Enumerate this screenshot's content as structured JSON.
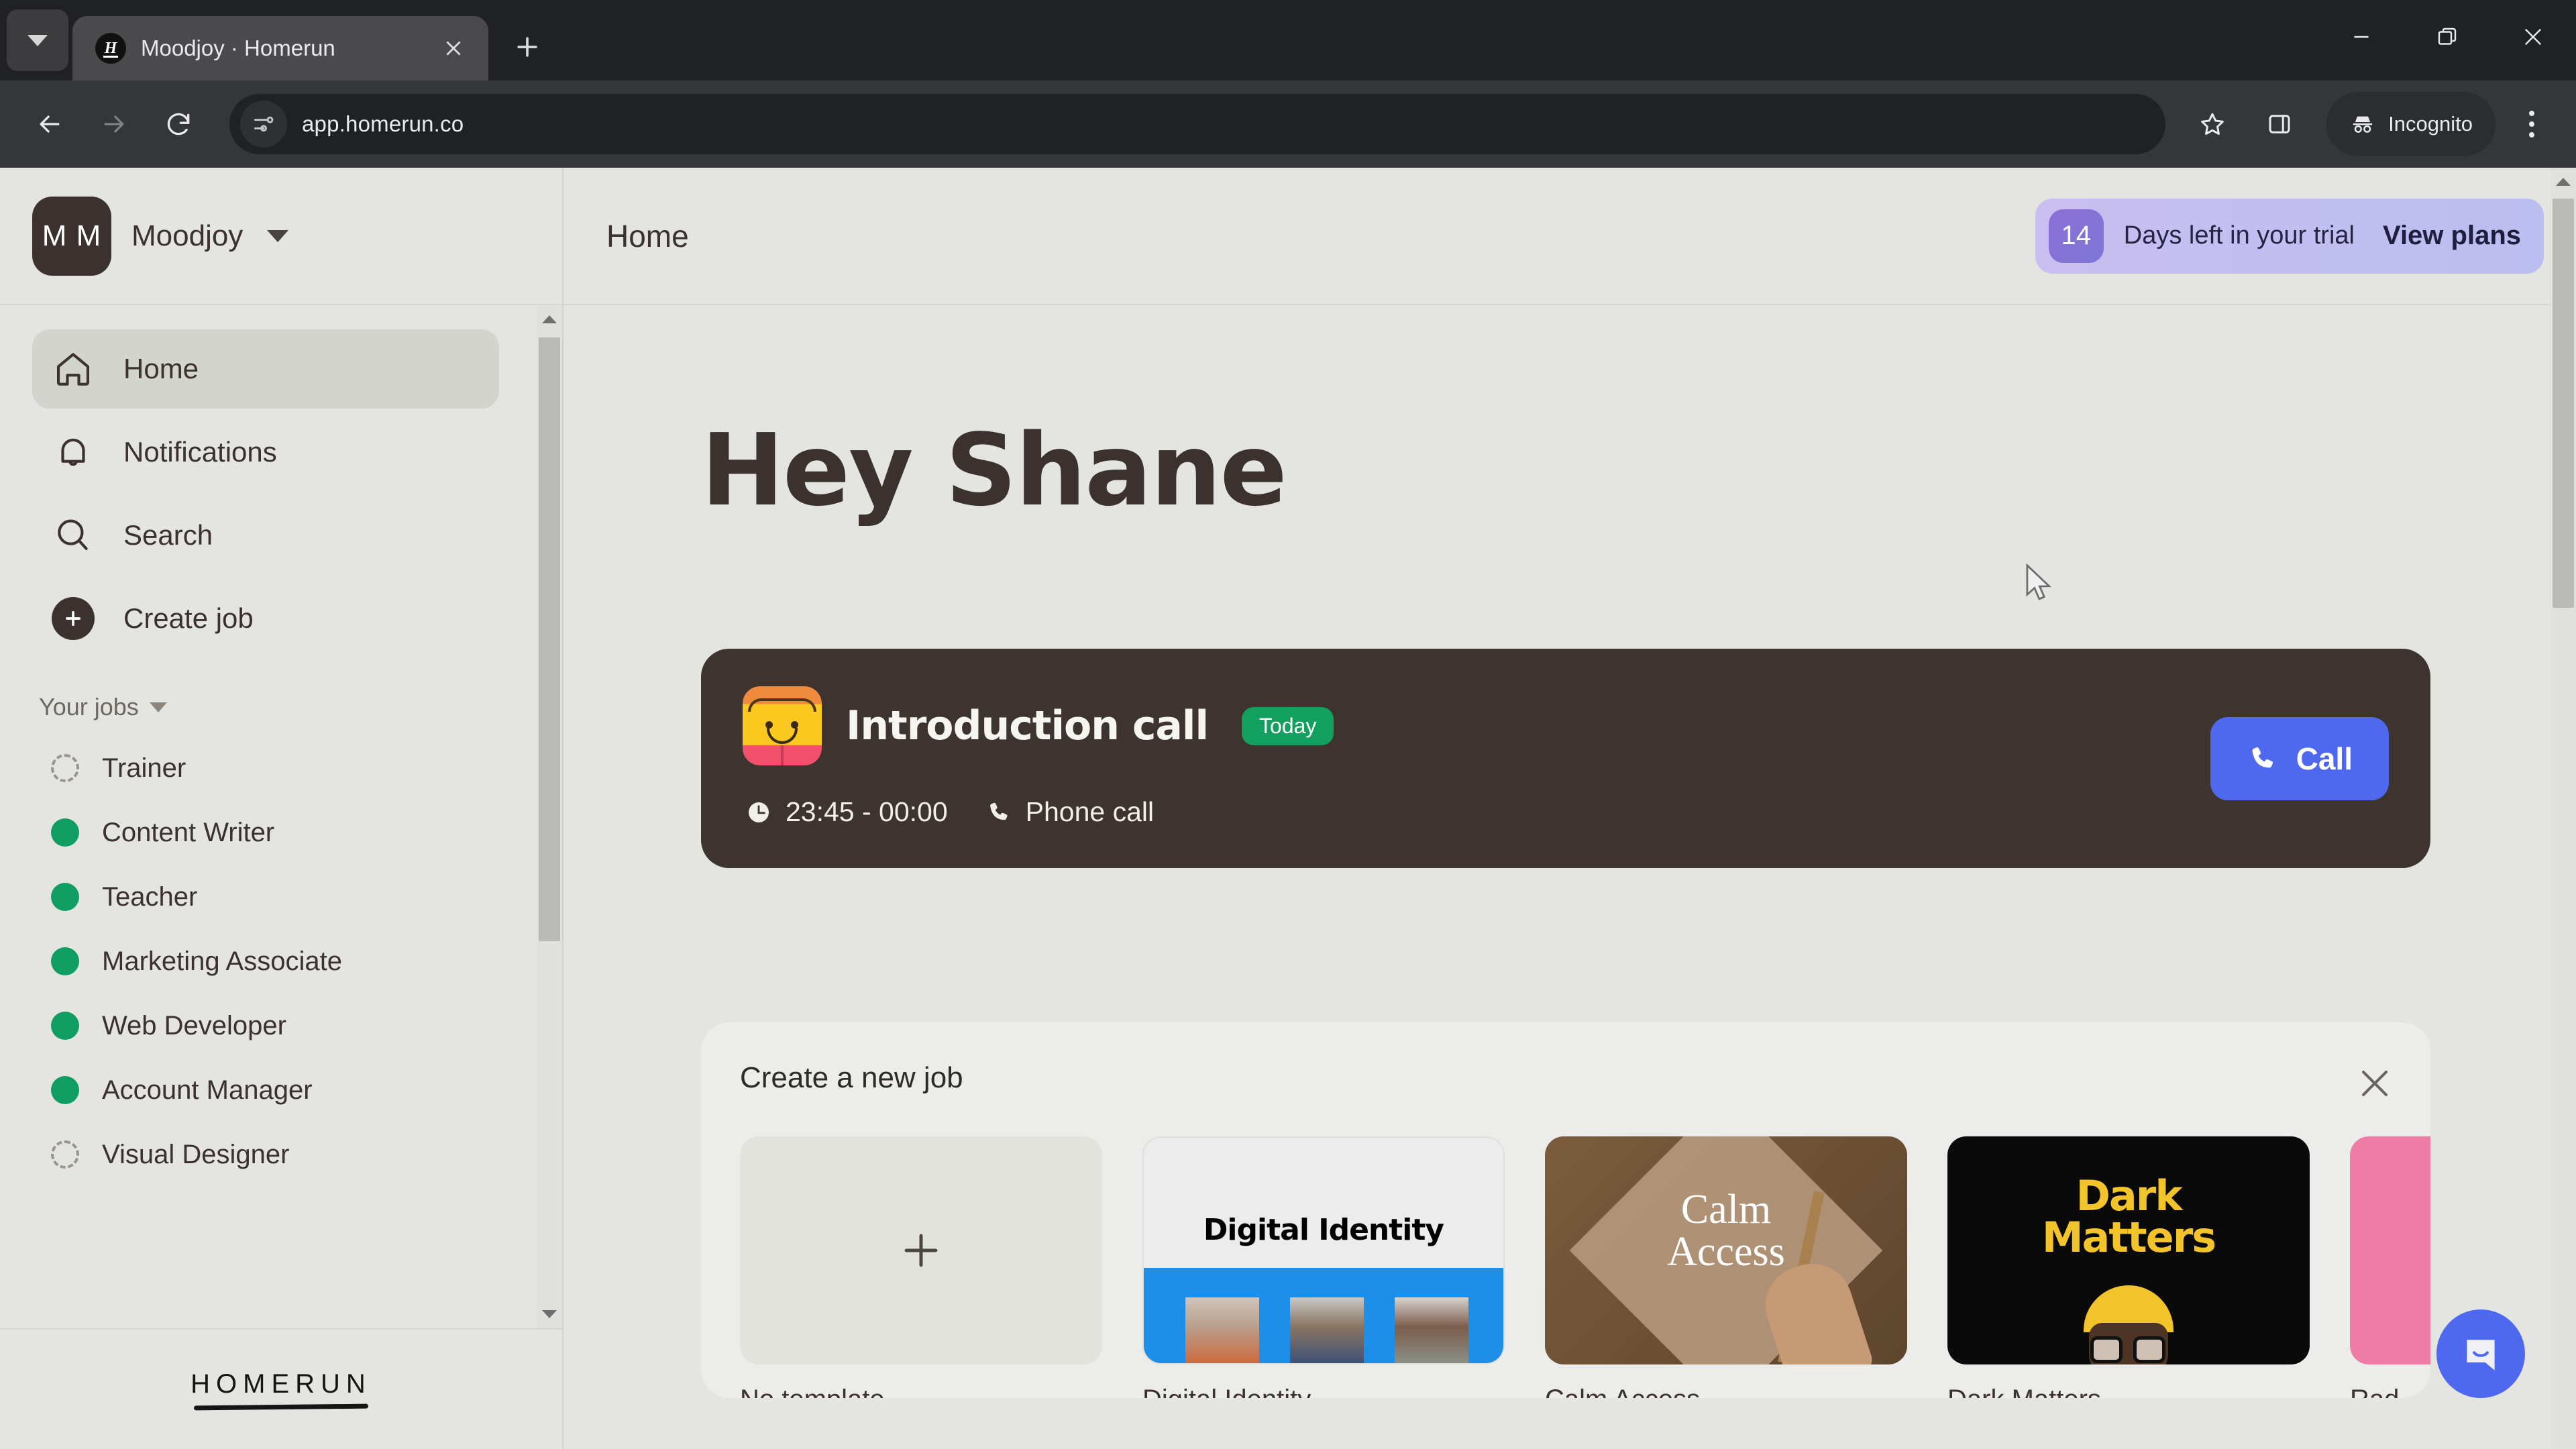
{
  "browser": {
    "tab": {
      "title": "Moodjoy · Homerun",
      "favicon_letter": "H"
    },
    "url": "app.homerun.co",
    "profile_label": "Incognito"
  },
  "sidebar": {
    "org": {
      "initials": "M M",
      "name": "Moodjoy"
    },
    "nav": [
      {
        "label": "Home",
        "icon": "home-icon",
        "active": true
      },
      {
        "label": "Notifications",
        "icon": "bell-icon",
        "active": false
      },
      {
        "label": "Search",
        "icon": "search-icon",
        "active": false
      },
      {
        "label": "Create job",
        "icon": "plus-circle-icon",
        "active": false
      }
    ],
    "section": {
      "label": "Your jobs"
    },
    "jobs": [
      {
        "label": "Trainer",
        "status": "draft"
      },
      {
        "label": "Content Writer",
        "status": "live"
      },
      {
        "label": "Teacher",
        "status": "live"
      },
      {
        "label": "Marketing Associate",
        "status": "live"
      },
      {
        "label": "Web Developer",
        "status": "live"
      },
      {
        "label": "Account Manager",
        "status": "live"
      },
      {
        "label": "Visual Designer",
        "status": "draft"
      }
    ],
    "footer_logo": "HOMERUN"
  },
  "header": {
    "title": "Home",
    "trial": {
      "days": "14",
      "text": "Days left in your trial",
      "link": "View plans"
    }
  },
  "main": {
    "greeting": "Hey Shane",
    "event": {
      "title": "Introduction call",
      "badge": "Today",
      "time": "23:45 - 00:00",
      "type": "Phone call",
      "action": "Call"
    },
    "new_job": {
      "title": "Create a new job",
      "templates": [
        {
          "name": "No template",
          "kind": "empty"
        },
        {
          "name": "Digital Identity",
          "kind": "digital-identity",
          "cover_text": "Digital Identity"
        },
        {
          "name": "Calm Access",
          "kind": "calm-access",
          "cover_text": "Calm\nAccess"
        },
        {
          "name": "Dark Matters",
          "kind": "dark-matters",
          "cover_text": "Dark\nMatters"
        },
        {
          "name": "Rad",
          "kind": "pink",
          "cover_text": ""
        }
      ]
    }
  },
  "colors": {
    "accent_blue": "#4e69ef",
    "status_green": "#0f9d63",
    "dark_brown": "#3d332f",
    "page_bg": "#e4e4e0",
    "trial_purple": "#c3bef1"
  }
}
